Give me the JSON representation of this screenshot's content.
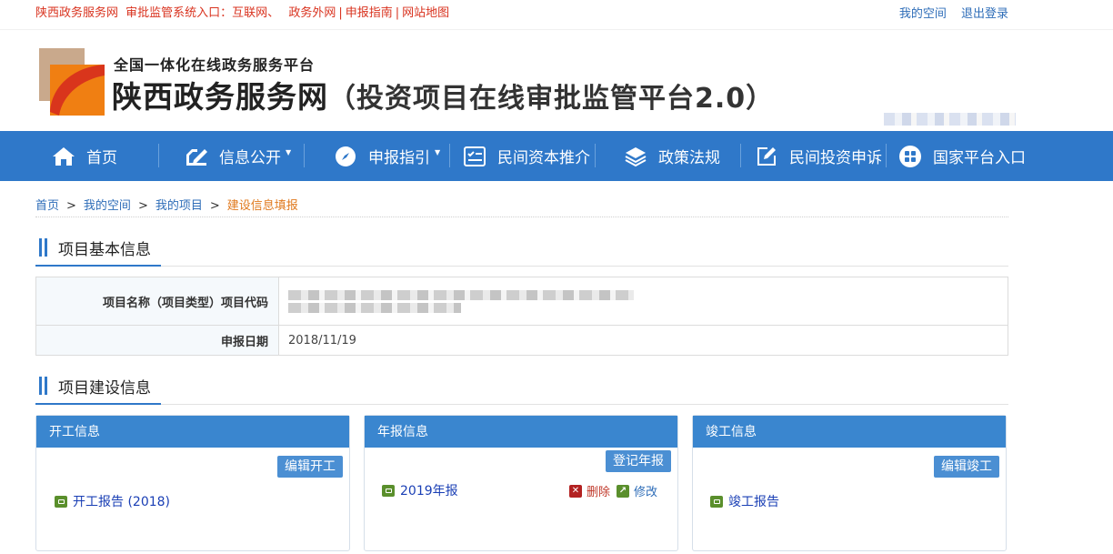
{
  "topbar": {
    "links": [
      "陕西政务服务网",
      "审批监管系统入口：",
      "互联网、",
      "政务外网",
      "申报指南",
      "网站地图"
    ],
    "right_links": [
      "我的空间",
      "退出登录"
    ]
  },
  "header": {
    "subtitle": "全国一体化在线政务服务平台",
    "title": "陕西政务服务网",
    "title_suffix": "（投资项目在线审批监管平台2.0）"
  },
  "nav": {
    "items": [
      {
        "label": "首页",
        "icon": "home-icon"
      },
      {
        "label": "信息公开",
        "icon": "edit-doc-icon"
      },
      {
        "label": "申报指引",
        "icon": "compass-icon"
      },
      {
        "label": "民间资本推介",
        "icon": "checklist-icon"
      },
      {
        "label": "政策法规",
        "icon": "layers-icon"
      },
      {
        "label": "民间投资申诉",
        "icon": "pencil-square-icon"
      },
      {
        "label": "国家平台入口",
        "icon": "grid-circle-icon"
      }
    ]
  },
  "breadcrumb": [
    "首页",
    "我的空间",
    "我的项目",
    "建设信息填报"
  ],
  "breadcrumb_sep": ">",
  "sections": {
    "basic": "项目基本信息",
    "construction": "项目建设信息"
  },
  "basic_info": {
    "name_label": "项目名称（项目类型）项目代码",
    "name_value_visible": "渭南市渭",
    "date_label": "申报日期",
    "date_value": "2018/11/19"
  },
  "cards": {
    "start": {
      "title": "开工信息",
      "button": "编辑开工",
      "file": "开工报告 (2018)"
    },
    "annual": {
      "title": "年报信息",
      "button": "登记年报",
      "file": "2019年报",
      "delete": "删除",
      "edit": "修改"
    },
    "complete": {
      "title": "竣工信息",
      "button": "编辑竣工",
      "file": "竣工报告"
    }
  },
  "colors": {
    "nav": "#2f78c9",
    "card_head": "#3a86cf",
    "link": "#2e6db8",
    "topbar_red": "#d9331f",
    "breadcrumb_current": "#e07a1f"
  }
}
